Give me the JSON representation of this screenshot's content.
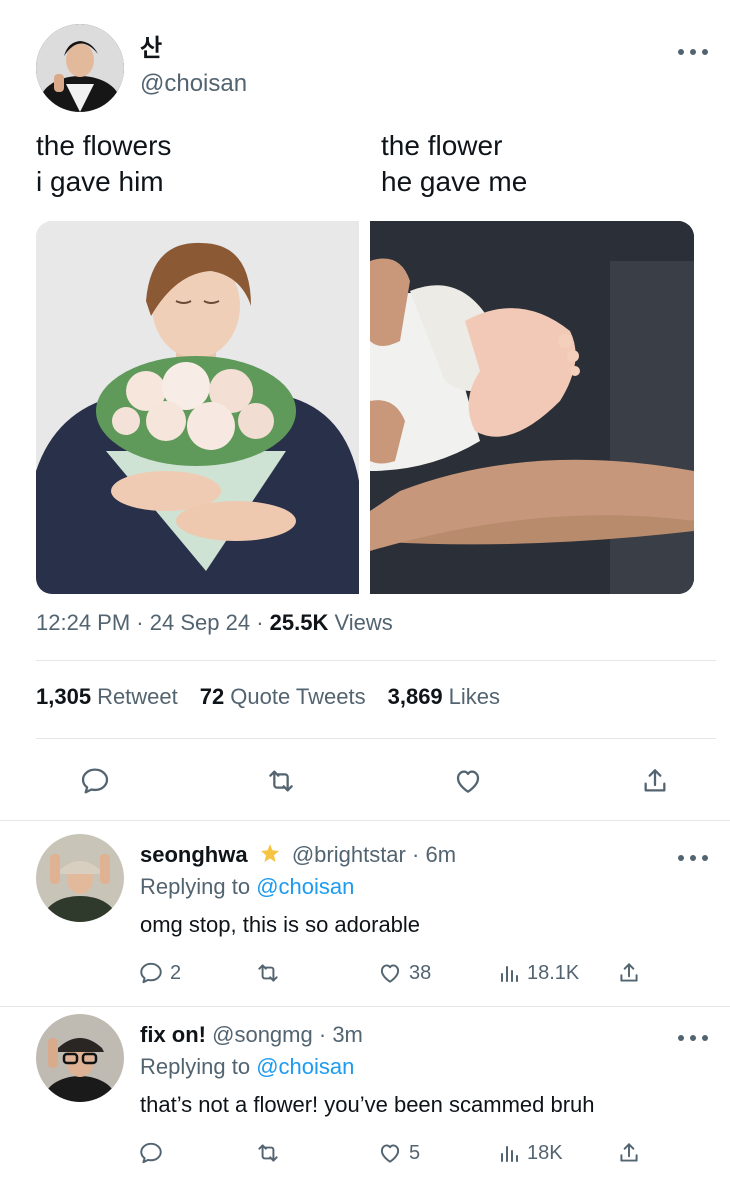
{
  "tweet": {
    "display_name": "산",
    "handle": "@choisan",
    "caption_left": "the flowers\ni gave him",
    "caption_right": "the flower\nhe gave me",
    "time": "12:24 PM",
    "date": "24 Sep 24",
    "views_count": "25.5K",
    "views_label": "Views",
    "separator": "·"
  },
  "stats": {
    "retweets": "1,305",
    "retweets_label": "Retweet",
    "quotes": "72",
    "quotes_label": "Quote Tweets",
    "likes": "3,869",
    "likes_label": "Likes"
  },
  "replies": [
    {
      "name": "seonghwa",
      "handle": "@brightstar",
      "time": "6m",
      "replying_label": "Replying to",
      "mention": "@choisan",
      "text": "omg stop, this is so adorable",
      "reply_count": "2",
      "retweet_count": "",
      "like_count": "38",
      "view_count": "18.1K"
    },
    {
      "name": "fix on!",
      "handle": "@songmg",
      "time": "3m",
      "replying_label": "Replying to",
      "mention": "@choisan",
      "text": "that’s not a flower! you’ve been scammed bruh",
      "reply_count": "",
      "retweet_count": "",
      "like_count": "5",
      "view_count": "18K"
    }
  ],
  "icons": {
    "reply": "speech-bubble-icon",
    "retweet": "retweet-icon",
    "like": "heart-icon",
    "share": "share-icon",
    "views": "bar-chart-icon",
    "verified": "star-badge-icon",
    "more": "more-dots-icon"
  },
  "colors": {
    "text": "#0f1419",
    "secondary": "#536471",
    "link": "#1d9bf0",
    "divider": "#e5e7ea",
    "badge": "#f5c542"
  }
}
